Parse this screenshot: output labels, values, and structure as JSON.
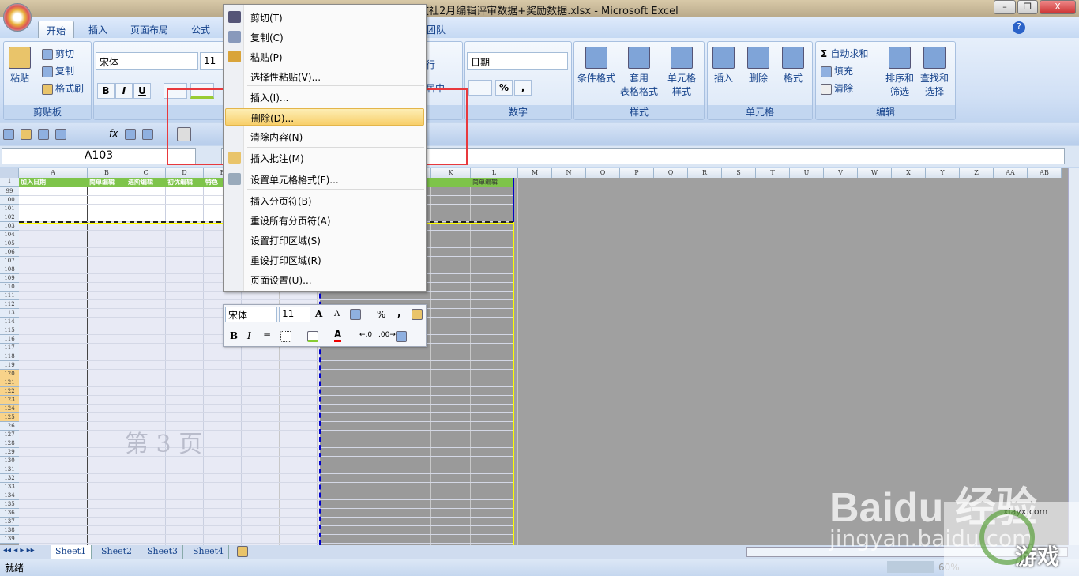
{
  "window": {
    "title": "文社2月编辑评审数据+奖励数据.xlsx - Microsoft Excel",
    "min": "–",
    "restore": "❐",
    "close": "X"
  },
  "tabs": [
    {
      "label": "开始"
    },
    {
      "label": "插入"
    },
    {
      "label": "页面布局"
    },
    {
      "label": "公式"
    },
    {
      "label": "团队"
    }
  ],
  "ribbon": {
    "clipboard": {
      "label": "剪贴板",
      "paste": "粘贴",
      "cut": "剪切",
      "copy": "复制",
      "format_painter": "格式刷"
    },
    "font": {
      "label": "字体",
      "font_name": "宋体",
      "font_size": "11",
      "bold": "B",
      "italic": "I",
      "underline": "U"
    },
    "alignment": {
      "wrap": "行",
      "merge": "居中"
    },
    "number": {
      "label": "数字",
      "format": "日期",
      "percent": "%",
      "comma": ","
    },
    "styles": {
      "label": "样式",
      "conditional": "条件格式",
      "table": "套用\n表格格式",
      "cell": "单元格\n样式"
    },
    "cells": {
      "label": "单元格",
      "insert": "插入",
      "delete": "删除",
      "format": "格式"
    },
    "editing": {
      "label": "编辑",
      "autosum": "自动求和",
      "fill": "填充",
      "clear": "清除",
      "sort": "排序和\n筛选",
      "find": "查找和\n选择"
    }
  },
  "formula_bar": {
    "name_box": "A103",
    "formula": "",
    "fx": "fx"
  },
  "columns": [
    "A",
    "B",
    "C",
    "D",
    "E",
    "F",
    "G",
    "H",
    "I",
    "J",
    "K",
    "L",
    "M",
    "N",
    "O",
    "P",
    "Q",
    "R",
    "S",
    "T",
    "U",
    "V",
    "W",
    "X",
    "Y",
    "Z",
    "AA",
    "AB"
  ],
  "header_row": {
    "row": "1",
    "A": "加入日期",
    "B": "简单编辑",
    "C": "进阶编辑",
    "D": "初优编辑",
    "E": "特色",
    "L": "简单编辑"
  },
  "rows_top": [
    "99",
    "100",
    "101",
    "102"
  ],
  "rows": [
    "103",
    "104",
    "105",
    "106",
    "107",
    "108",
    "109",
    "110",
    "111",
    "112",
    "113",
    "114",
    "115",
    "116",
    "117",
    "118",
    "119",
    "120",
    "121",
    "122",
    "123",
    "124",
    "125",
    "126",
    "127",
    "128",
    "129",
    "130",
    "131",
    "132",
    "133",
    "134",
    "135",
    "136",
    "137",
    "138",
    "139"
  ],
  "page_watermark": "第 3 页",
  "context_menu": [
    {
      "label": "剪切(T)",
      "icon": "scissors"
    },
    {
      "label": "复制(C)",
      "icon": "copy"
    },
    {
      "label": "粘贴(P)",
      "icon": "paste"
    },
    {
      "label": "选择性粘贴(V)..."
    },
    {
      "label": "插入(I)..."
    },
    {
      "label": "删除(D)...",
      "highlighted": true
    },
    {
      "label": "清除内容(N)"
    },
    {
      "label": "插入批注(M)",
      "icon": "comment"
    },
    {
      "label": "设置单元格格式(F)...",
      "icon": "format-cells"
    },
    {
      "label": "插入分页符(B)"
    },
    {
      "label": "重设所有分页符(A)"
    },
    {
      "label": "设置打印区域(S)"
    },
    {
      "label": "重设打印区域(R)"
    },
    {
      "label": "页面设置(U)..."
    }
  ],
  "mini_toolbar": {
    "font": "宋体",
    "size": "11",
    "grow": "A",
    "shrink": "A",
    "percent": "%",
    "comma": ",",
    "bold": "B",
    "italic": "I",
    "font_color": "A"
  },
  "sheets": [
    {
      "label": "Sheet1",
      "active": true
    },
    {
      "label": "Sheet2"
    },
    {
      "label": "Sheet3"
    },
    {
      "label": "Sheet4"
    }
  ],
  "status": {
    "ready": "就绪",
    "zoom": "60%"
  },
  "watermark": {
    "baidu": "Baidu 经验",
    "url": "jingyan.baidu.com",
    "site": "xiayx.com",
    "game": "游戏"
  },
  "colors": {
    "highlight_box": "#e8393d",
    "header_green": "#7ec44a",
    "page_break": "#0000cc"
  }
}
